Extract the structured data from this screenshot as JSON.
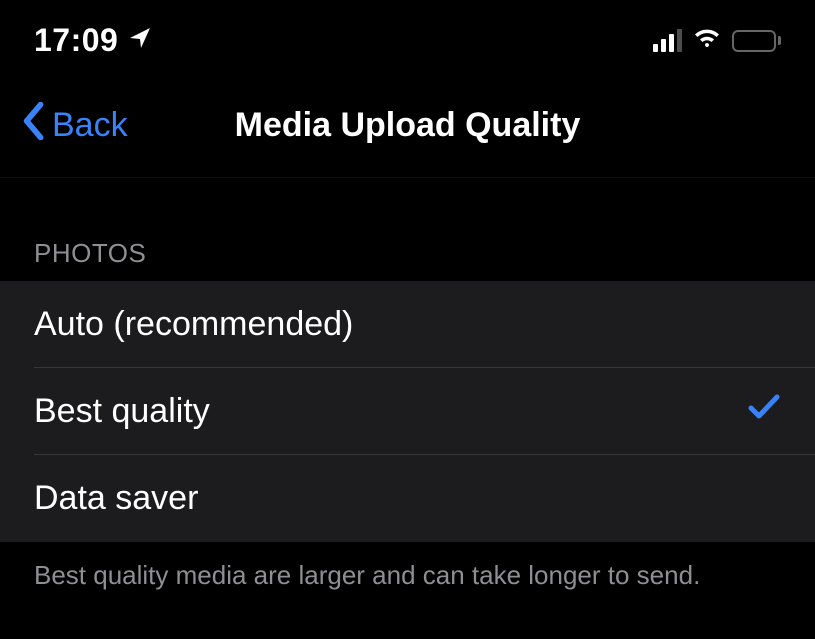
{
  "status": {
    "time": "17:09"
  },
  "nav": {
    "back_label": "Back",
    "title": "Media Upload Quality"
  },
  "section": {
    "header": "Photos",
    "footer": "Best quality media are larger and can take longer to send."
  },
  "options": [
    {
      "label": "Auto (recommended)",
      "selected": false
    },
    {
      "label": "Best quality",
      "selected": true
    },
    {
      "label": "Data saver",
      "selected": false
    }
  ],
  "colors": {
    "accent": "#3a82f7"
  }
}
